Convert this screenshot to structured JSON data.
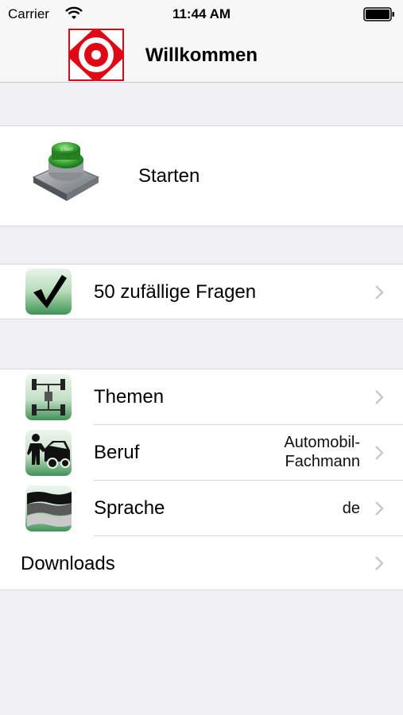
{
  "status_bar": {
    "carrier": "Carrier",
    "time": "11:44 AM"
  },
  "nav": {
    "title": "Willkommen",
    "logo_icon": "brand-logo-icon",
    "brand_color": "#e30613"
  },
  "start": {
    "label": "Starten",
    "icon": "start-button-icon"
  },
  "random": {
    "label": "50 zufällige Fragen",
    "icon": "checkmark-icon"
  },
  "settings": [
    {
      "label": "Themen",
      "detail": "",
      "icon": "themes-icon"
    },
    {
      "label": "Beruf",
      "detail_line1": "Automobil-",
      "detail_line2": "Fachmann",
      "icon": "profession-icon"
    },
    {
      "label": "Sprache",
      "detail": "de",
      "icon": "language-flag-icon"
    },
    {
      "label": "Downloads",
      "detail": ""
    }
  ]
}
